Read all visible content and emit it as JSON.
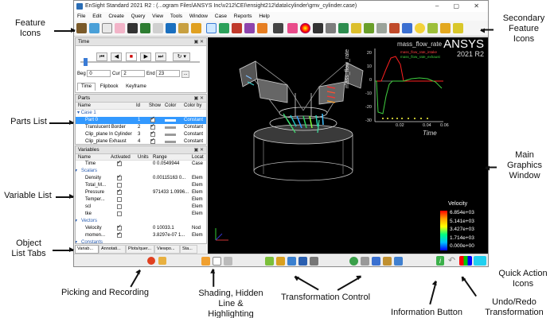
{
  "window": {
    "title": "EnSight Standard 2021 R2 : (...ogram Files\\ANSYS Inc\\v212\\CEI\\ensight212\\data\\cylinder\\gmv_cylinder.case)",
    "controls": "–  ▢  ✕"
  },
  "menu": [
    "File",
    "Edit",
    "Create",
    "Query",
    "View",
    "Tools",
    "Window",
    "Case",
    "Reports",
    "Help"
  ],
  "time_panel": {
    "title": "Time",
    "beg_label": "Beg",
    "beg_value": "0",
    "cur_label": "Cur",
    "cur_value": "2",
    "end_label": "End",
    "end_value": "23",
    "more_button": "...",
    "tabs": [
      "Time",
      "Flipbook",
      "Keyframe"
    ]
  },
  "parts_panel": {
    "title": "Parts",
    "columns": [
      "Name",
      "Id",
      "Show",
      "Color",
      "Color by"
    ],
    "rows": [
      {
        "name": "Case 1",
        "id": "",
        "color_by": ""
      },
      {
        "name": "Part 0",
        "id": "1",
        "color_by": "Constant"
      },
      {
        "name": "Translucent Border",
        "id": "2",
        "color_by": "Constant"
      },
      {
        "name": "Clip_plane In Cylinder",
        "id": "3",
        "color_by": "Constant"
      },
      {
        "name": "Clip_plane Exhaust",
        "id": "4",
        "color_by": "Constant"
      }
    ]
  },
  "variables_panel": {
    "title": "Variables",
    "columns": [
      "Name",
      "Activated",
      "Units",
      "Range",
      "Locat"
    ],
    "rows": [
      {
        "name": "Time",
        "activated": true,
        "range": "0  0.0549944",
        "loc": "Case"
      },
      {
        "name": "Scalars",
        "group": true
      },
      {
        "name": "Density",
        "activated": true,
        "range": "0.00115163  0...",
        "loc": "Elem"
      },
      {
        "name": "Total_M...",
        "activated": false,
        "range": "",
        "loc": "Elem"
      },
      {
        "name": "Pressure",
        "activated": true,
        "range": "971433  1.0996...",
        "loc": "Elem"
      },
      {
        "name": "Temper...",
        "activated": false,
        "range": "",
        "loc": "Elem"
      },
      {
        "name": "scl",
        "activated": false,
        "range": "",
        "loc": "Elem"
      },
      {
        "name": "tke",
        "activated": false,
        "range": "",
        "loc": "Elem"
      },
      {
        "name": "Vectors",
        "group": true
      },
      {
        "name": "Velocity",
        "activated": true,
        "range": "0  10033.1",
        "loc": "Nod"
      },
      {
        "name": "momen...",
        "activated": true,
        "range": "3.8297e-07  1...",
        "loc": "Elem"
      },
      {
        "name": "Constants",
        "group": true
      },
      {
        "name": "Crank_a...",
        "activated": false,
        "range": "",
        "loc": "Case"
      },
      {
        "name": "Analysis...",
        "activated": false,
        "range": "",
        "loc": "Case"
      }
    ]
  },
  "object_tabs": [
    "Variab...",
    "Annotati...",
    "Plots/quer...",
    "Viewpo...",
    "Sta..."
  ],
  "viewport": {
    "brand": "ANSYS",
    "version": "2021 R2",
    "legend_title": "Velocity",
    "legend_values": [
      "6.854e+03",
      "5.141e+03",
      "3.427e+03",
      "1.714e+03",
      "0.000e+00"
    ]
  },
  "plot": {
    "title": "mass_flow_rate",
    "xlabel": "Time",
    "ylabel": "mass_flow_rate",
    "y_ticks": [
      "20",
      "10",
      "0",
      "-10",
      "-20",
      "-30"
    ],
    "x_ticks": [
      "0.02",
      "0.04",
      "0.06"
    ],
    "legend": [
      "mass_flow_rate_intake",
      "mass_flow_rate_exhaust"
    ]
  },
  "callouts": {
    "feature_icons": "Feature\nIcons",
    "secondary_feature_icons": "Secondary\nFeature\nIcons",
    "parts_list": "Parts List",
    "main_graphics_window": "Main\nGraphics\nWindow",
    "variable_list": "Variable List",
    "object_list_tabs": "Object\nList Tabs",
    "quick_action_icons": "Quick Action\nIcons",
    "picking_and_recording": "Picking and Recording",
    "shading": "Shading, Hidden\nLine & Highlighting",
    "transformation_control": "Transformation Control",
    "information_button": "Information Button",
    "undo_redo": "Undo/Redo\nTransformation"
  },
  "colors": {
    "viewport_bg": "#000000",
    "selection_blue": "#3399ff",
    "plot_intake": "#ff2020",
    "plot_exhaust": "#40d040"
  }
}
